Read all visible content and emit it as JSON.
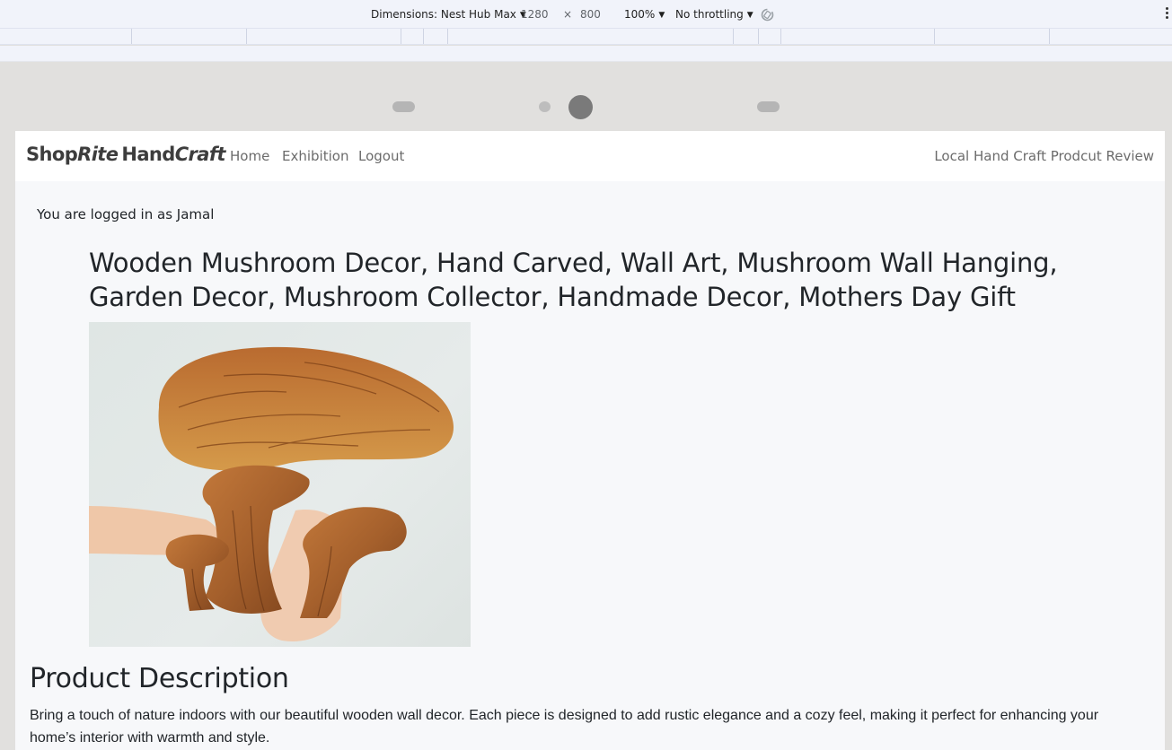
{
  "devtools": {
    "device_label": "Dimensions: Nest Hub Max",
    "width": "1280",
    "times": "×",
    "height": "800",
    "zoom": "100%",
    "throttling": "No throttling",
    "caret": "▼",
    "icons": [
      "rotate-icon",
      "more-options-icon"
    ]
  },
  "navbar": {
    "brand_shop": "Shop",
    "brand_rite": "Rite",
    "brand_hand": "Hand",
    "brand_craft": "Craft",
    "links": [
      "Home",
      "Exhibition",
      "Logout"
    ],
    "right_text": "Local Hand Craft Prodcut Review"
  },
  "main": {
    "logged_in_text": "You are logged in as Jamal",
    "product_title": "Wooden Mushroom Decor, Hand Carved, Wall Art, Mushroom Wall Hanging, Garden Decor, Mushroom Collector, Handmade Decor, Mothers Day Gift",
    "section_heading": "Product Description",
    "description": "Bring a touch of nature indoors with our beautiful wooden wall decor. Each piece is designed to add rustic elegance and a cozy feel, making it perfect for enhancing your home’s interior with warmth and style."
  },
  "colors": {
    "devtools_bg": "#f1f3fa",
    "page_bg": "#f7f8fa",
    "text": "#212529",
    "nav_text": "#6b6b6b",
    "wood": "#a5602c"
  }
}
